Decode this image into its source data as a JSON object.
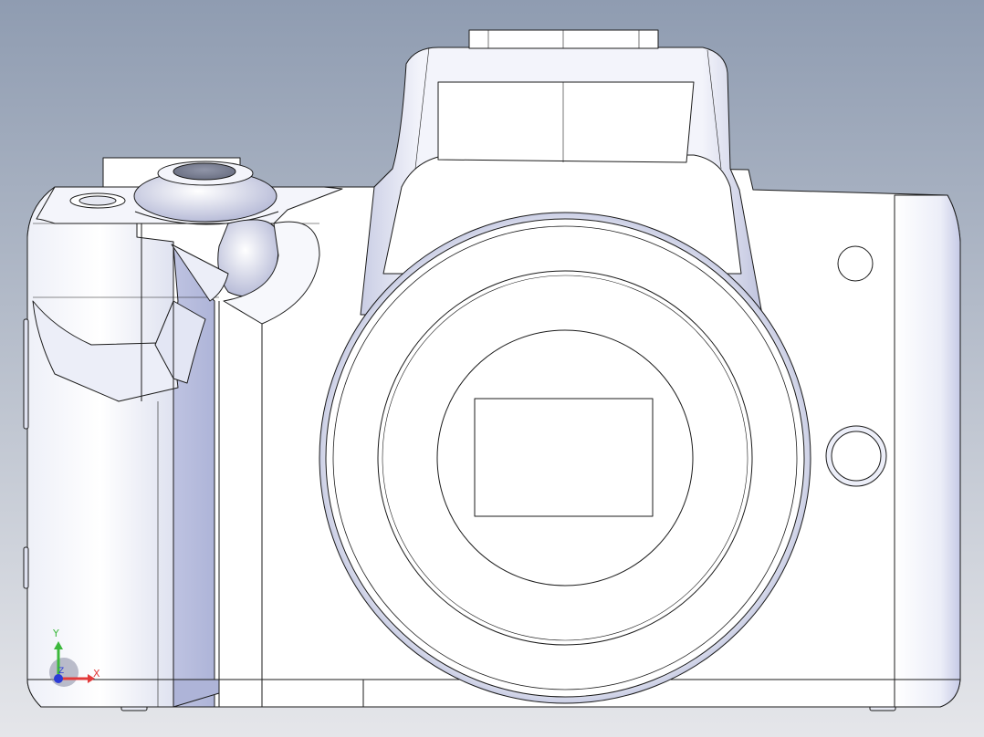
{
  "viewport": {
    "background_top": "#8f9cb1",
    "background_bottom": "#e5e6ea",
    "model_fill": "#ffffff",
    "model_shade": "#c9cde4",
    "model_shade_dark": "#a9aed0",
    "edge_color": "#1b1b1b"
  },
  "triad": {
    "x_label": "X",
    "y_label": "Y",
    "z_label": "Z",
    "x_color": "#e23b3b",
    "y_color": "#3cb83c",
    "z_color": "#2b3bd6"
  }
}
